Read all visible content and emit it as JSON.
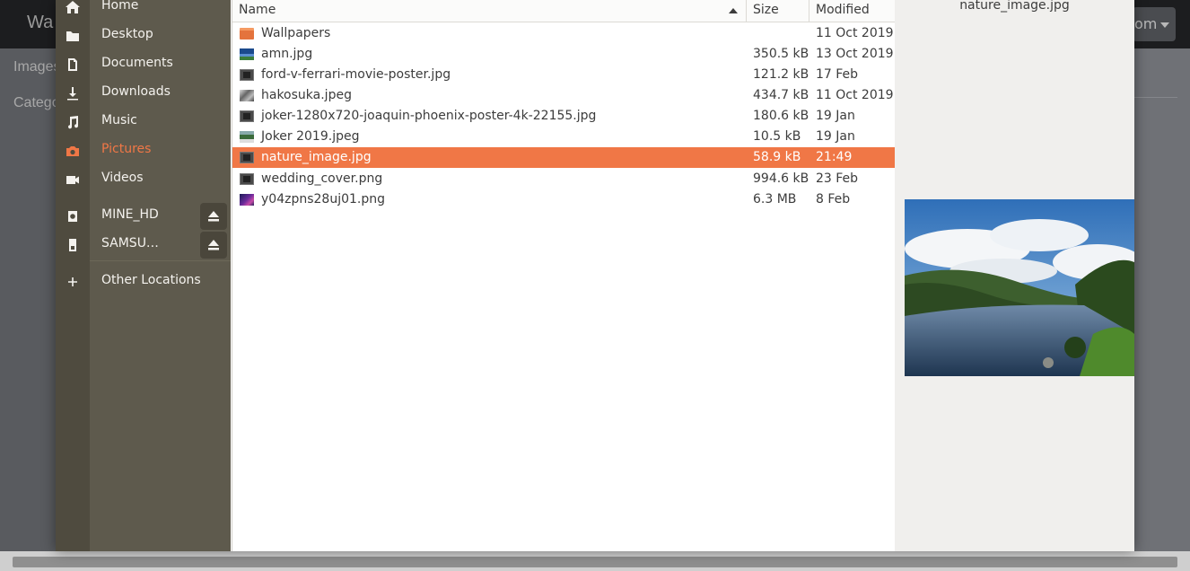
{
  "background": {
    "brand": "Wa",
    "sidebar_items": [
      "Images",
      "Catego"
    ],
    "account_label": "om"
  },
  "places": [
    {
      "label": "Home",
      "icon": "home-icon"
    },
    {
      "label": "Desktop",
      "icon": "folder-icon"
    },
    {
      "label": "Documents",
      "icon": "document-icon"
    },
    {
      "label": "Downloads",
      "icon": "download-icon"
    },
    {
      "label": "Music",
      "icon": "music-icon"
    },
    {
      "label": "Pictures",
      "icon": "camera-icon",
      "active": true
    },
    {
      "label": "Videos",
      "icon": "video-icon"
    },
    {
      "label": "MINE_HD",
      "icon": "drive-icon",
      "eject": true
    },
    {
      "label": "SAMSU…",
      "icon": "usb-drive-icon",
      "eject": true
    },
    {
      "label": "Other Locations",
      "icon": "plus-icon"
    }
  ],
  "columns": {
    "name": "Name",
    "size": "Size",
    "modified": "Modified"
  },
  "files": [
    {
      "name": "Wallpapers",
      "size": "",
      "modified": "11 Oct 2019",
      "icon": "folder-icon"
    },
    {
      "name": "amn.jpg",
      "size": "350.5 kB",
      "modified": "13 Oct 2019",
      "icon": "image-thumbnail-icon"
    },
    {
      "name": "ford-v-ferrari-movie-poster.jpg",
      "size": "121.2 kB",
      "modified": "17 Feb",
      "icon": "image-file-icon"
    },
    {
      "name": "hakosuka.jpeg",
      "size": "434.7 kB",
      "modified": "11 Oct 2019",
      "icon": "image-thumbnail-icon"
    },
    {
      "name": "joker-1280x720-joaquin-phoenix-poster-4k-22155.jpg",
      "size": "180.6 kB",
      "modified": "19 Jan",
      "icon": "image-file-icon"
    },
    {
      "name": "Joker 2019.jpeg",
      "size": "10.5 kB",
      "modified": "19 Jan",
      "icon": "image-thumbnail-icon"
    },
    {
      "name": "nature_image.jpg",
      "size": "58.9 kB",
      "modified": "21:49",
      "icon": "image-file-icon",
      "selected": true
    },
    {
      "name": "wedding_cover.png",
      "size": "994.6 kB",
      "modified": "23 Feb",
      "icon": "image-file-icon"
    },
    {
      "name": "y04zpns28uj01.png",
      "size": "6.3 MB",
      "modified": "8 Feb",
      "icon": "image-thumbnail-icon"
    }
  ],
  "preview": {
    "filename": "nature_image.jpg"
  },
  "colors": {
    "accent": "#f07746",
    "places_bg": "#5e5a4d",
    "preview_bg": "#f0efed"
  }
}
